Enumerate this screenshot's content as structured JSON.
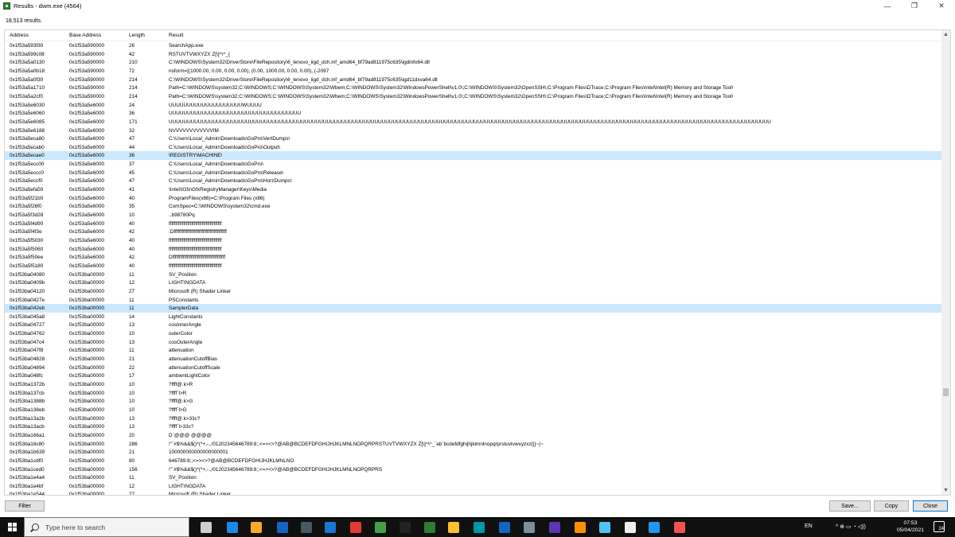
{
  "window": {
    "title": "Results - dwm.exe (4564)",
    "minimize": "—",
    "maximize": "❐",
    "close": "✕"
  },
  "results_count": "18,513 results.",
  "columns": [
    "Address",
    "Base Address",
    "Length",
    "Result"
  ],
  "selected_rows": [
    13,
    31
  ],
  "rows": [
    [
      "0x1f53a593f30",
      "0x1f53a590000",
      "26",
      "SearchApp.exe"
    ],
    [
      "0x1f53a599c08",
      "0x1f53a590000",
      "42",
      "RSTUVTVWXYZX Z[\\]^\\^_{"
    ],
    [
      "0x1f53a5a0130",
      "0x1f53a590000",
      "210",
      "C:\\WINDOWS\\System32\\DriverStore\\FileRepository\\6_lenovo_iigd_dch.inf_amd64_bf79ad811975c635\\igdinfo64.dll"
    ],
    [
      "0x1f53a5a0b18",
      "0x1f53a590000",
      "72",
      "nsform=[(1000.00, 0.00, 0.00, 0.00), (0.00, 1000.00, 0.00, 0.00), (-2097"
    ],
    [
      "0x1f53a5a0f30",
      "0x1f53a590000",
      "214",
      "C:\\WINDOWS\\System32\\DriverStore\\FileRepository\\6_lenovo_iigd_dch.inf_amd64_bf79ad811975c635\\igd11dxva64.dll"
    ],
    [
      "0x1f53a5a1710",
      "0x1f53a590000",
      "214",
      "Path=C:\\WINDOWS\\system32;C:\\WINDOWS;C:\\WINDOWS\\System32\\Wbem;C:\\WINDOWS\\System32\\WindowsPowerShell\\v1.0\\;C:\\WINDOWS\\System32\\OpenSSH\\;C:\\Program Files\\DTrace;C:\\Program Files\\Intel\\Intel(R) Memory and Storage Tool\\"
    ],
    [
      "0x1f53a5a2cf0",
      "0x1f53a590000",
      "214",
      "Path=C:\\WINDOWS\\system32;C:\\WINDOWS;C:\\WINDOWS\\System32\\Wbem;C:\\WINDOWS\\System32\\WindowsPowerShell\\v1.0\\;C:\\WINDOWS\\System32\\OpenSSH\\;C:\\Program Files\\DTrace;C:\\Program Files\\Intel\\Intel(R) Memory and Storage Tool\\"
    ],
    [
      "0x1f53a5e6030",
      "0x1f53a5e6000",
      "24",
      "UUUUUUUUUUUUUUUUUUUUWUUUU"
    ],
    [
      "0x1f53a5e6060",
      "0x1f53a5e6000",
      "36",
      "UUUUUUUUUUUUUUUUUUUUUUUUUUUUUUUUUUUU"
    ],
    [
      "0x1f53a5e6085",
      "0x1f53a5e6000",
      "171",
      "UUUUUUUUUUUUUUUUUUUUUUUUUUUUUUUUUUUUUUUUUUUUUUUUUUUUUUUUUUUUUUUUUUUUUUUUUUUUUUUUUUUUUUUUUUUUUUUUUUUUUUUUUUUUUUUUUUUUUUUUUUUUUUUUUUUUUUUUUUUUUUUUUUUUUUUUUUUUUUUUUUUU"
    ],
    [
      "0x1f53a5e6188",
      "0x1f53a5e6000",
      "32",
      "NVVVVVVVVVVVVIM"
    ],
    [
      "0x1f53a5eca80",
      "0x1f53a5e6000",
      "47",
      "C:\\Users\\Local_Admin\\Downloads\\GoPro\\VertDumps\\"
    ],
    [
      "0x1f53a5ecab0",
      "0x1f53a5e6000",
      "44",
      "C:\\Users\\Local_Admin\\Downloads\\GoPro\\Output\\"
    ],
    [
      "0x1f53a5ecae0",
      "0x1f53a5e6000",
      "36",
      "\\REGISTRY\\MACHINE\\"
    ],
    [
      "0x1f53a5ecc00",
      "0x1f53a5e6000",
      "37",
      "C:\\Users\\Local_Admin\\Downloads\\GoPro\\"
    ],
    [
      "0x1f53a5eccc0",
      "0x1f53a5e6000",
      "45",
      "C:\\Users\\Local_Admin\\Downloads\\GoPro\\Release\\"
    ],
    [
      "0x1f53a5eccf0",
      "0x1f53a5e6000",
      "47",
      "C:\\Users\\Local_Admin\\Downloads\\GoPro\\HorzDumps\\"
    ],
    [
      "0x1f53a5efa50",
      "0x1f53a5e6000",
      "41",
      "\\Intel\\IGfx\\GfxRegistryManager\\Keys\\Media"
    ],
    [
      "0x1f53a5f21b0",
      "0x1f53a5e6000",
      "40",
      "ProgramFiles(x86)=C:\\Program Files (x86)"
    ],
    [
      "0x1f53a5f26f0",
      "0x1f53a5e6000",
      "35",
      "ComSpec=C:\\WINDOWS\\system32\\cmd.exe"
    ],
    [
      "0x1f53a5f3d28",
      "0x1f53a5e6000",
      "10",
      "..b98780Pq"
    ],
    [
      "0x1f53a5f4d90",
      "0x1f53a5e6000",
      "40",
      "ffffffffffffffffffffffffffffffffffffffff"
    ],
    [
      "0x1f53a5f4f3e",
      "0x1f53a5e6000",
      "42",
      ".Dffffffffffffffffffffffffffffffffffffffff"
    ],
    [
      "0x1f53a5f5030",
      "0x1f53a5e6000",
      "40",
      "ffffffffffffffffffffffffffffffffffffffff"
    ],
    [
      "0x1f53a5f5060",
      "0x1f53a5e6000",
      "40",
      "ffffffffffffffffffffffffffffffffffffffff"
    ],
    [
      "0x1f53a5f50ee",
      "0x1f53a5e6000",
      "42",
      "Dffffffffffffffffffffffffffffffffffffffff"
    ],
    [
      "0x1f53a5f5180",
      "0x1f53a5e6000",
      "40",
      "ffffffffffffffffffffffffffffffffffffffff"
    ],
    [
      "0x1f53ba04080",
      "0x1f53ba00000",
      "11",
      "SV_Position"
    ],
    [
      "0x1f53ba0409b",
      "0x1f53ba00000",
      "12",
      "LIGHTINGDATA"
    ],
    [
      "0x1f53ba04120",
      "0x1f53ba00000",
      "27",
      "Microsoft (R) Shader Linker"
    ],
    [
      "0x1f53ba0427e",
      "0x1f53ba00000",
      "11",
      "PSConstants"
    ],
    [
      "0x1f53ba042eb",
      "0x1f53ba00000",
      "11",
      "SamplerData"
    ],
    [
      "0x1f53ba045a8",
      "0x1f53ba00000",
      "14",
      "LightConstants"
    ],
    [
      "0x1f53ba04727",
      "0x1f53ba00000",
      "13",
      "cosInnerAngle"
    ],
    [
      "0x1f53ba04762",
      "0x1f53ba00000",
      "10",
      "outerColor"
    ],
    [
      "0x1f53ba047c4",
      "0x1f53ba00000",
      "13",
      "cosOuterAngle"
    ],
    [
      "0x1f53ba047f8",
      "0x1f53ba00000",
      "11",
      "attenuation"
    ],
    [
      "0x1f53ba04828",
      "0x1f53ba00000",
      "21",
      "attenuationCutoffBias"
    ],
    [
      "0x1f53ba04894",
      "0x1f53ba00000",
      "22",
      "attenuationCutoffScale"
    ],
    [
      "0x1f53ba048fc",
      "0x1f53ba00000",
      "17",
      "ambientLightColor"
    ],
    [
      "0x1f53ba1372b",
      "0x1f53ba00000",
      "10",
      "?ffff@.k>R"
    ],
    [
      "0x1f53ba137cb",
      "0x1f53ba00000",
      "10",
      "?ffff`l>R"
    ],
    [
      "0x1f53ba1388b",
      "0x1f53ba00000",
      "10",
      "?ffff@.k>G"
    ],
    [
      "0x1f53ba138eb",
      "0x1f53ba00000",
      "10",
      "?ffff`l>G"
    ],
    [
      "0x1f53ba13a2b",
      "0x1f53ba00000",
      "13",
      "?ffff@.k>33c?"
    ],
    [
      "0x1f53ba13acb",
      "0x1f53ba00000",
      "13",
      "?ffff`l>33c?"
    ],
    [
      "0x1f53ba166a1",
      "0x1f53ba00000",
      "20",
      "D`@@@ @@@@"
    ],
    [
      "0x1f53ba16c80",
      "0x1f53ba00000",
      "286",
      "!\"`#$%&&$()*(*+,-.,/01202345646789:8;;<=><>?@AB@BCDEFDFGHIJHJKLMNLNOPQRPRSTUVTVWXYZX Z[\\]^\\^_`ab`bcdefdfghijhjklmnlnopqrprstuvtvwxyzxz{|}~|~"
    ],
    [
      "0x1f53ba1b639",
      "0x1f53ba00000",
      "21",
      "100000000000000000001"
    ],
    [
      "0x1f53ba1cdf0",
      "0x1f53ba00000",
      "80",
      "646789:8;;<=><>?@AB@BCDEFDFGHIJHJKLMNLNO"
    ],
    [
      "0x1f53ba1ced0",
      "0x1f53ba00000",
      "156",
      "!\"`#$%&&$()*(*+,-.,/01202345646789:8;;<=><>?@AB@BCDEFDFGHIJHJKLMNLNOPQRPRS"
    ],
    [
      "0x1f53ba1e4a4",
      "0x1f53ba00000",
      "11",
      "SV_Position"
    ],
    [
      "0x1f53ba1e4bf",
      "0x1f53ba00000",
      "12",
      "LIGHTINGDATA"
    ],
    [
      "0x1f53ba1e544",
      "0x1f53ba00000",
      "27",
      "Microsoft (R) Shader Linker"
    ]
  ],
  "buttons": {
    "filter": "Filter",
    "save": "Save...",
    "copy": "Copy",
    "close": "Close"
  },
  "taskbar": {
    "search_placeholder": "Type here to search",
    "language": "EN",
    "time": "07:53",
    "date": "05/04/2021",
    "notifications": "24",
    "pinned_icons": [
      "task-view-icon",
      "edge-icon",
      "file-explorer-icon",
      "mail-icon",
      "terminal-icon",
      "powershell-icon",
      "media-icon",
      "app-icon",
      "command-prompt-icon",
      "excel-icon",
      "chrome-icon",
      "photos-icon",
      "word-icon",
      "system-informer-icon",
      "visual-studio-icon",
      "search-app-icon",
      "notepad-icon",
      "7zip-icon",
      "paint-icon",
      "snipping-icon"
    ]
  },
  "colors": {
    "selection": "#cce8ff",
    "taskbar": "#101010",
    "close_border": "#0078d7"
  }
}
